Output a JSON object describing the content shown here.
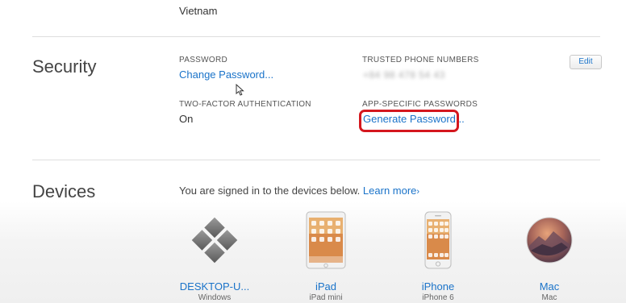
{
  "account": {
    "country": "Vietnam"
  },
  "security": {
    "title": "Security",
    "password_label": "PASSWORD",
    "change_password_link": "Change Password...",
    "trusted_phone_label": "TRUSTED PHONE NUMBERS",
    "trusted_phone_value": "+84 98 478 54 43",
    "edit_button": "Edit",
    "two_factor_label": "TWO-FACTOR AUTHENTICATION",
    "two_factor_value": "On",
    "app_passwords_label": "APP-SPECIFIC PASSWORDS",
    "generate_password_link": "Generate Password..."
  },
  "devices": {
    "title": "Devices",
    "signed_in_text": "You are signed in to the devices below.",
    "learn_more_link": "Learn more",
    "learn_more_chevron": "›",
    "items": [
      {
        "name": "DESKTOP-U...",
        "model": "Windows",
        "icon": "windows-pc-icon"
      },
      {
        "name": "iPad",
        "model": "iPad mini",
        "icon": "ipad-icon"
      },
      {
        "name": "iPhone",
        "model": "iPhone 6",
        "icon": "iphone-icon"
      },
      {
        "name": "Mac",
        "model": "Mac",
        "icon": "mac-icon"
      }
    ]
  },
  "colors": {
    "link": "#1a73c9",
    "highlight": "#d4171e"
  }
}
